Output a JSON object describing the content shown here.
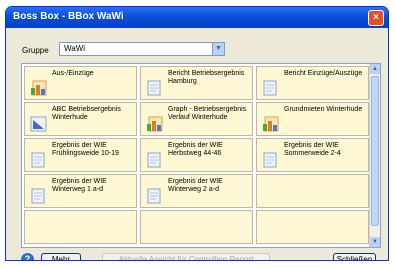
{
  "window": {
    "title": "Boss Box - BBox WaWi"
  },
  "group": {
    "label": "Gruppe",
    "value": "WaWi"
  },
  "tiles": [
    {
      "label": "Aus-/Einzüge",
      "icon": "chart-icon"
    },
    {
      "label": "Bericht Betriebsergebnis Hamburg",
      "icon": "document-icon"
    },
    {
      "label": "Bericht Einzüge/Auszüge",
      "icon": "document-icon"
    },
    {
      "label": "ABC Betriebsergebnis Winterhude",
      "icon": "blue-chart-icon"
    },
    {
      "label": "Graph - Betriebsergebnis Verlauf Winterhude",
      "icon": "chart-icon"
    },
    {
      "label": "Grundmieten Winterhude",
      "icon": "chart-icon"
    },
    {
      "label": "Ergebnis der WIE Frühlingsweide 10-19",
      "icon": "document-icon"
    },
    {
      "label": "Ergebnis der WIE Herbstweg 44-46",
      "icon": "document-icon"
    },
    {
      "label": "Ergebnis der WIE Sommerweide 2-4",
      "icon": "document-icon"
    },
    {
      "label": "Ergebnis der WIE Winterweg 1 a-d",
      "icon": "document-icon"
    },
    {
      "label": "Ergebnis der WIE Winterweg 2 a-d",
      "icon": "document-icon"
    },
    {
      "label": "",
      "icon": ""
    },
    {
      "label": "",
      "icon": ""
    },
    {
      "label": "",
      "icon": ""
    },
    {
      "label": "",
      "icon": ""
    }
  ],
  "buttons": {
    "more": "Mehr",
    "apply": "Aktuelle Ansicht für Controlling Report übernehmen",
    "close": "Schließen"
  },
  "icons": {
    "help": "help-icon",
    "close": "close-icon",
    "dropdown": "chevron-down-icon"
  }
}
